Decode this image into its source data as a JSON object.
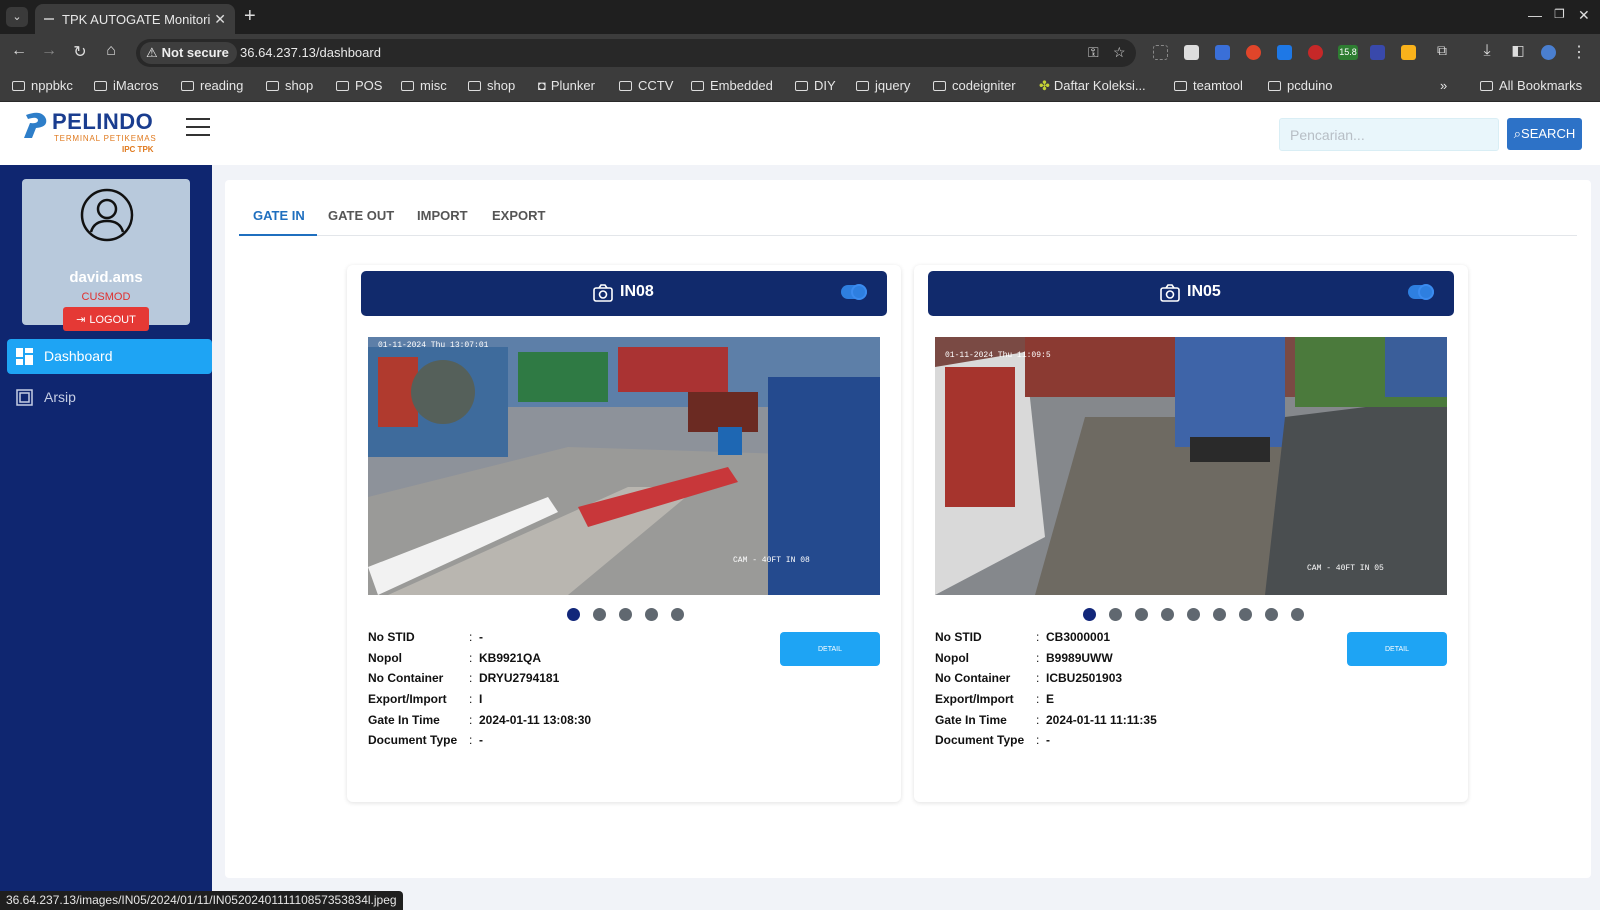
{
  "browser": {
    "tab_title": "TPK AUTOGATE Monitoring",
    "new_tab": "+",
    "security_label": "Not secure",
    "url": "36.64.237.13/dashboard",
    "more_bookmarks": "»",
    "bookmarks": [
      "nppbkc",
      "iMacros",
      "reading",
      "shop",
      "POS",
      "misc",
      "shop",
      "Plunker",
      "CCTV",
      "Embedded",
      "DIY",
      "jquery",
      "codeigniter",
      "Daftar Koleksi...",
      "teamtool",
      "pcduino"
    ],
    "all_bookmarks": "All Bookmarks",
    "extension_badge": "15.8",
    "status_url": "36.64.237.13/images/IN05/2024/01/11/IN0520240111110857353834l.jpeg"
  },
  "header": {
    "logo_text": "PELINDO",
    "logo_sub": "TERMINAL PETIKEMAS",
    "logo_ipc": "IPC TPK",
    "search_placeholder": "Pencarian...",
    "search_label": "SEARCH"
  },
  "sidebar": {
    "username": "david.ams",
    "role": "CUSMOD",
    "logout_label": "LOGOUT",
    "items": [
      {
        "label": "Dashboard",
        "icon": "dashboard-icon",
        "active": true
      },
      {
        "label": "Arsip",
        "icon": "archive-icon",
        "active": false
      }
    ]
  },
  "tabs": [
    "GATE IN",
    "GATE OUT",
    "IMPORT",
    "EXPORT"
  ],
  "gates": [
    {
      "name": "IN08",
      "camera_overlay_time": "01-11-2024 Thu 13:07:01",
      "camera_overlay_label": "CAM - 40FT IN 08",
      "slides": 5,
      "active_slide": 0,
      "detail_label": "DETAIL",
      "fields": [
        {
          "label": "No STID",
          "value": "-"
        },
        {
          "label": "Nopol",
          "value": "KB9921QA"
        },
        {
          "label": "No Container",
          "value": "DRYU2794181"
        },
        {
          "label": "Export/Import",
          "value": "I"
        },
        {
          "label": "Gate In Time",
          "value": "2024-01-11 13:08:30"
        },
        {
          "label": "Document Type",
          "value": "-"
        }
      ]
    },
    {
      "name": "IN05",
      "camera_overlay_time": "01-11-2024 Thu 11:09:5",
      "camera_overlay_label": "CAM - 40FT IN 05",
      "slides": 9,
      "active_slide": 0,
      "detail_label": "DETAIL",
      "fields": [
        {
          "label": "No STID",
          "value": "CB3000001"
        },
        {
          "label": "Nopol",
          "value": "B9989UWW"
        },
        {
          "label": "No Container",
          "value": "ICBU2501903"
        },
        {
          "label": "Export/Import",
          "value": "E"
        },
        {
          "label": "Gate In Time",
          "value": "2024-01-11 11:11:35"
        },
        {
          "label": "Document Type",
          "value": "-"
        }
      ]
    }
  ],
  "colors": {
    "sidebar": "#0f2670",
    "card_header": "#112a6c",
    "accent": "#1ea4f4",
    "tab_active": "#1f6fbf",
    "logout": "#e53935"
  }
}
